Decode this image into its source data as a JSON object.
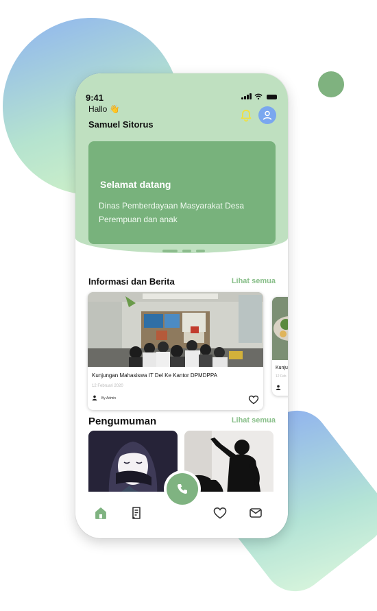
{
  "status": {
    "time": "9:41"
  },
  "header": {
    "greeting": "Hallo 👋",
    "user_name": "Samuel Sitorus"
  },
  "banner": {
    "title": "Selamat datang",
    "subtitle": "Dinas Pemberdayaan Masyarakat Desa Perempuan dan anak",
    "slide_count": 3,
    "active_slide": 1
  },
  "news": {
    "title": "Informasi dan Berita",
    "see_all": "Lihat semua",
    "items": [
      {
        "title": "Kunjungan Mahasiswa IT Del Ke Kantor DPMDPPA",
        "date": "12 Februari 2020",
        "author": "By Admin"
      },
      {
        "title": "Kunju",
        "date": "12 Feb"
      }
    ]
  },
  "announcements": {
    "title": "Pengumuman",
    "see_all": "Lihat semua"
  },
  "nav": {
    "items": [
      "home-icon",
      "document-icon",
      "heart-icon",
      "mail-icon"
    ],
    "call": "phone-icon"
  },
  "colors": {
    "primary_green": "#78b27c",
    "header_bg": "#bfe0c0",
    "accent_link": "#89bf8a",
    "avatar_blue": "#7aa7ef",
    "bell_yellow": "#f2e13a"
  }
}
